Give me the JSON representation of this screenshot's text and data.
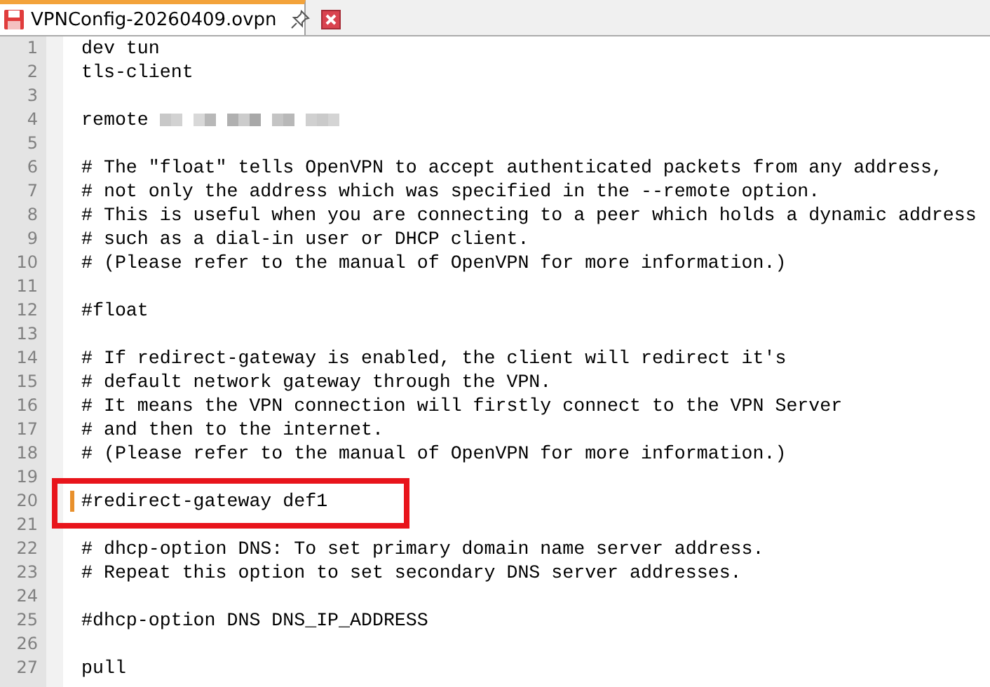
{
  "tab": {
    "title": "VPNConfig-20260409.ovpn",
    "selected": true
  },
  "lines": [
    {
      "number": "1",
      "text": "dev tun"
    },
    {
      "number": "2",
      "text": "tls-client"
    },
    {
      "number": "3"
    },
    {
      "number": "4",
      "text": "remote",
      "redacted": true
    },
    {
      "number": "5"
    },
    {
      "number": "6",
      "text": "# The \"float\" tells OpenVPN to accept authenticated packets from any address,"
    },
    {
      "number": "7",
      "text": "# not only the address which was specified in the --remote option."
    },
    {
      "number": "8",
      "text": "# This is useful when you are connecting to a peer which holds a dynamic address"
    },
    {
      "number": "9",
      "text": "# such as a dial-in user or DHCP client."
    },
    {
      "number": "10",
      "text": "# (Please refer to the manual of OpenVPN for more information.)"
    },
    {
      "number": "11"
    },
    {
      "number": "12",
      "text": "#float"
    },
    {
      "number": "13"
    },
    {
      "number": "14",
      "text": "# If redirect-gateway is enabled, the client will redirect it's"
    },
    {
      "number": "15",
      "text": "# default network gateway through the VPN."
    },
    {
      "number": "16",
      "text": "# It means the VPN connection will firstly connect to the VPN Server"
    },
    {
      "number": "17",
      "text": "# and then to the internet."
    },
    {
      "number": "18",
      "text": "# (Please refer to the manual of OpenVPN for more information.)"
    },
    {
      "number": "19"
    },
    {
      "number": "20",
      "text": "#redirect-gateway def1",
      "changed": true,
      "boxed": true
    },
    {
      "number": "21"
    },
    {
      "number": "22",
      "text": "# dhcp-option DNS: To set primary domain name server address."
    },
    {
      "number": "23",
      "text": "# Repeat this option to set secondary DNS server addresses."
    },
    {
      "number": "24"
    },
    {
      "number": "25",
      "text": "#dhcp-option DNS DNS_IP_ADDRESS"
    },
    {
      "number": "26"
    },
    {
      "number": "27",
      "text": "pull"
    }
  ]
}
